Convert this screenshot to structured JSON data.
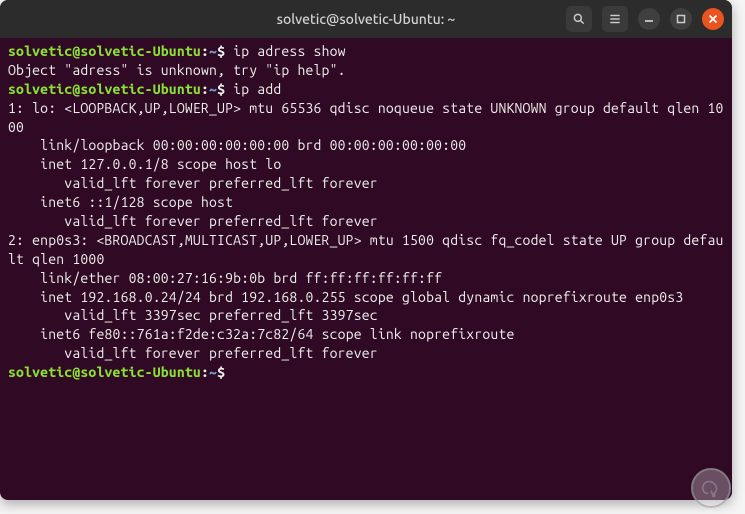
{
  "window": {
    "title": "solvetic@solvetic-Ubuntu: ~"
  },
  "prompt": {
    "user_host": "solvetic@solvetic-Ubuntu",
    "colon": ":",
    "path": "~",
    "dollar": "$"
  },
  "commands": {
    "cmd1": "ip adress show",
    "cmd2": "ip add",
    "cmd3": ""
  },
  "output": {
    "err1": "Object \"adress\" is unknown, try \"ip help\".",
    "line1": "1: lo: <LOOPBACK,UP,LOWER_UP> mtu 65536 qdisc noqueue state UNKNOWN group default qlen 1000",
    "line2": "    link/loopback 00:00:00:00:00:00 brd 00:00:00:00:00:00",
    "line3": "    inet 127.0.0.1/8 scope host lo",
    "line4": "       valid_lft forever preferred_lft forever",
    "line5": "    inet6 ::1/128 scope host ",
    "line6": "       valid_lft forever preferred_lft forever",
    "line7": "2: enp0s3: <BROADCAST,MULTICAST,UP,LOWER_UP> mtu 1500 qdisc fq_codel state UP group default qlen 1000",
    "line8": "    link/ether 08:00:27:16:9b:0b brd ff:ff:ff:ff:ff:ff",
    "line9": "    inet 192.168.0.24/24 brd 192.168.0.255 scope global dynamic noprefixroute enp0s3",
    "line10": "       valid_lft 3397sec preferred_lft 3397sec",
    "line11": "    inet6 fe80::761a:f2de:c32a:7c82/64 scope link noprefixroute ",
    "line12": "       valid_lft forever preferred_lft forever"
  }
}
